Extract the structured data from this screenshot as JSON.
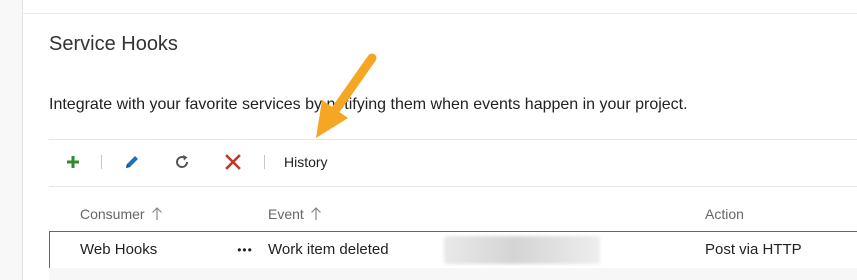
{
  "page": {
    "title": "Service Hooks",
    "description": "Integrate with your favorite services by notifying them when events happen in your project."
  },
  "toolbar": {
    "add_icon": "plus-icon",
    "edit_icon": "pencil-icon",
    "refresh_icon": "refresh-icon",
    "delete_icon": "close-icon",
    "history_label": "History"
  },
  "table": {
    "columns": [
      {
        "label": "Consumer",
        "sort": "ascending"
      },
      {
        "label": "Event",
        "sort": "ascending"
      },
      {
        "label": "Action"
      }
    ],
    "rows": [
      {
        "consumer": "Web Hooks",
        "more": "•••",
        "event": "Work item deleted",
        "action": "Post via HTTP"
      }
    ]
  },
  "colors": {
    "add": "#2e8b2e",
    "edit": "#1f6fbf",
    "refresh": "#555555",
    "delete": "#c0392b",
    "selected_row_border": "#3b6fb5",
    "annotation_arrow": "#f5a623"
  }
}
